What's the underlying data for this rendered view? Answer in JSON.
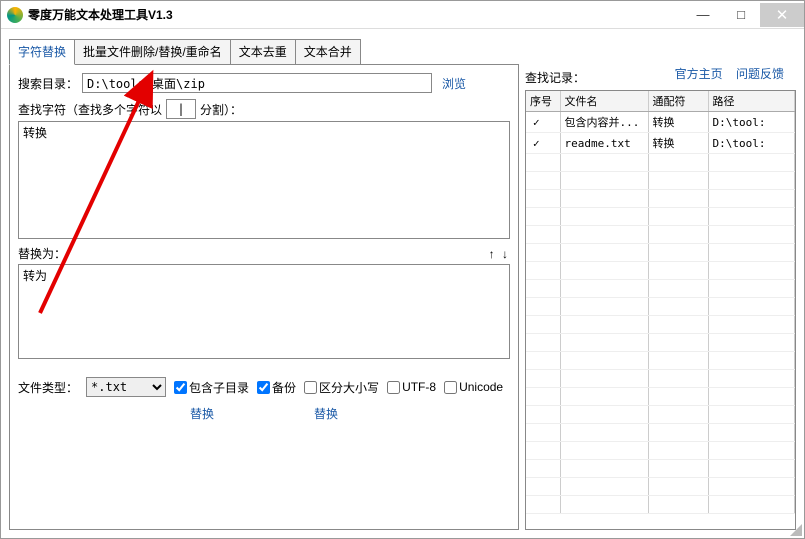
{
  "titlebar": {
    "title": "零度万能文本处理工具V1.3"
  },
  "winbtns": {
    "min": "—",
    "max": "□",
    "close": "✕"
  },
  "headerlinks": {
    "home": "官方主页",
    "feedback": "问题反馈"
  },
  "tabs": {
    "t0": "字符替换",
    "t1": "批量文件删除/替换/重命名",
    "t2": "文本去重",
    "t3": "文本合并"
  },
  "left": {
    "search_dir_label": "搜索目录：",
    "search_dir_value": "D:\\tools\\桌面\\zip",
    "browse": "浏览",
    "find_label_pre": "查找字符（查找多个字符以",
    "find_sep_value": "|",
    "find_label_post": "分割）：",
    "find_value": "转换",
    "replace_label": "替换为：",
    "arrows": "↑ ↓",
    "replace_value": "转为",
    "filetype_label": "文件类型：",
    "filetype_value": "*.txt",
    "chk_subdir": "包含子目录",
    "chk_backup": "备份",
    "chk_case": "区分大小写",
    "chk_utf8": "UTF-8",
    "chk_unicode": "Unicode",
    "action_replace1": "替换",
    "action_replace2": "替换"
  },
  "right": {
    "label": "查找记录：",
    "cols": {
      "c0": "序号",
      "c1": "文件名",
      "c2": "通配符",
      "c3": "路径"
    },
    "rows": [
      {
        "file": "包含内容并...",
        "wc": "转换",
        "path": "D:\\tool:"
      },
      {
        "file": "readme.txt",
        "wc": "转换",
        "path": "D:\\tool:"
      }
    ]
  }
}
